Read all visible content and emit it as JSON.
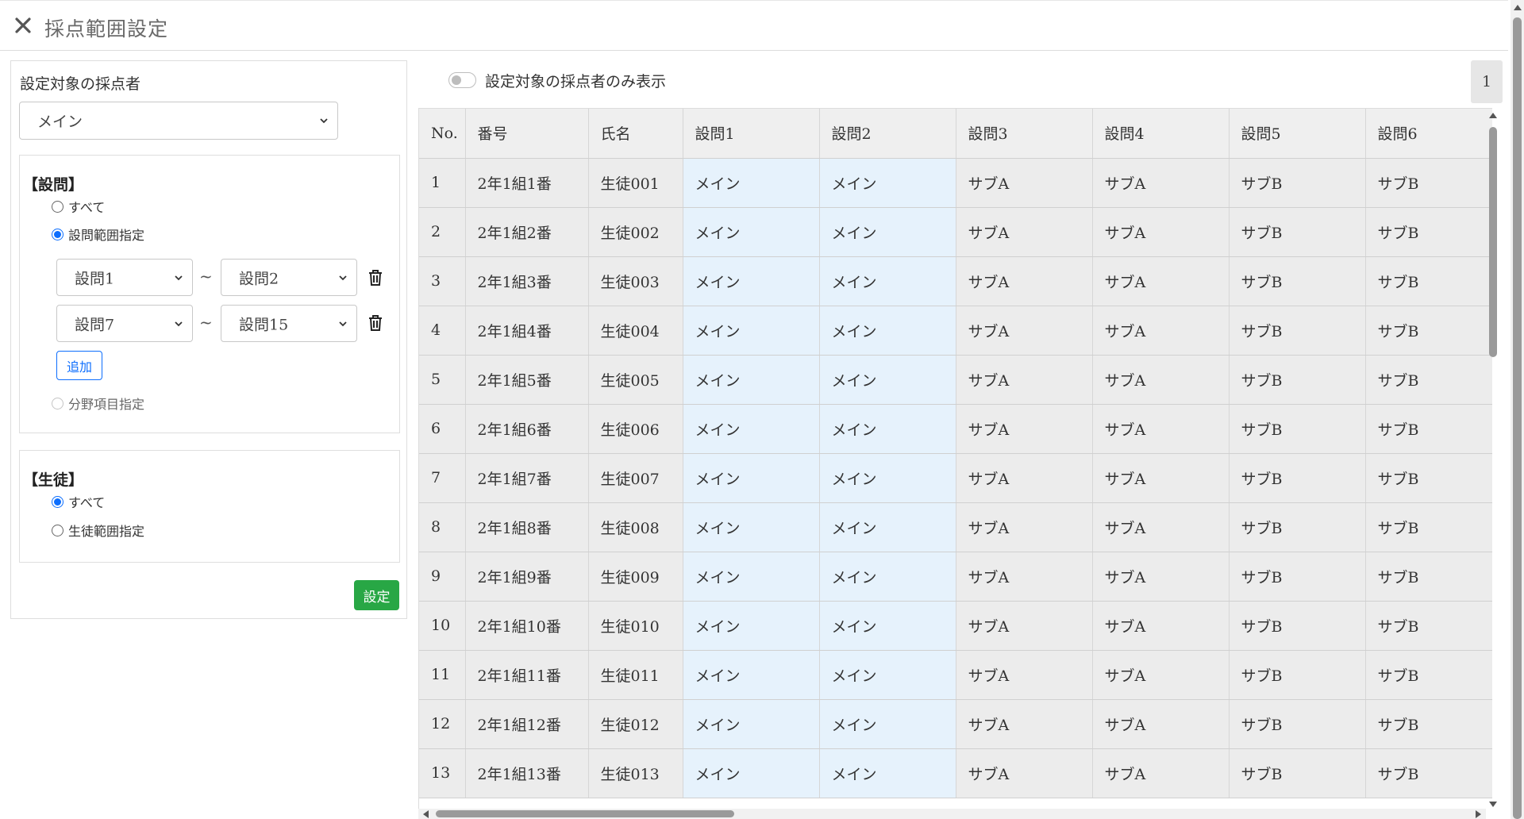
{
  "header": {
    "title": "採点範囲設定",
    "close_icon": "close-icon"
  },
  "panel": {
    "target_label": "設定対象の採点者",
    "target_value": "メイン",
    "questions": {
      "heading": "【設問】",
      "opt_all": "すべて",
      "opt_range": "設問範囲指定",
      "selected": "range",
      "ranges": [
        {
          "from": "設問1",
          "to": "設問2"
        },
        {
          "from": "設問7",
          "to": "設問15"
        }
      ],
      "tilde": "~",
      "add_label": "追加",
      "opt_field": "分野項目指定"
    },
    "students": {
      "heading": "【生徒】",
      "opt_all": "すべて",
      "opt_range": "生徒範囲指定",
      "selected": "all"
    },
    "set_label": "設定"
  },
  "toolbar": {
    "toggle_label": "設定対象の採点者のみ表示",
    "toggle_on": false,
    "page": "1"
  },
  "table": {
    "columns": [
      "No.",
      "番号",
      "氏名",
      "設問1",
      "設問2",
      "設問3",
      "設問4",
      "設問5",
      "設問6"
    ],
    "rows": [
      [
        "1",
        "2年1組1番",
        "生徒001",
        "メイン",
        "メイン",
        "サブA",
        "サブA",
        "サブB",
        "サブB"
      ],
      [
        "2",
        "2年1組2番",
        "生徒002",
        "メイン",
        "メイン",
        "サブA",
        "サブA",
        "サブB",
        "サブB"
      ],
      [
        "3",
        "2年1組3番",
        "生徒003",
        "メイン",
        "メイン",
        "サブA",
        "サブA",
        "サブB",
        "サブB"
      ],
      [
        "4",
        "2年1組4番",
        "生徒004",
        "メイン",
        "メイン",
        "サブA",
        "サブA",
        "サブB",
        "サブB"
      ],
      [
        "5",
        "2年1組5番",
        "生徒005",
        "メイン",
        "メイン",
        "サブA",
        "サブA",
        "サブB",
        "サブB"
      ],
      [
        "6",
        "2年1組6番",
        "生徒006",
        "メイン",
        "メイン",
        "サブA",
        "サブA",
        "サブB",
        "サブB"
      ],
      [
        "7",
        "2年1組7番",
        "生徒007",
        "メイン",
        "メイン",
        "サブA",
        "サブA",
        "サブB",
        "サブB"
      ],
      [
        "8",
        "2年1組8番",
        "生徒008",
        "メイン",
        "メイン",
        "サブA",
        "サブA",
        "サブB",
        "サブB"
      ],
      [
        "9",
        "2年1組9番",
        "生徒009",
        "メイン",
        "メイン",
        "サブA",
        "サブA",
        "サブB",
        "サブB"
      ],
      [
        "10",
        "2年1組10番",
        "生徒010",
        "メイン",
        "メイン",
        "サブA",
        "サブA",
        "サブB",
        "サブB"
      ],
      [
        "11",
        "2年1組11番",
        "生徒011",
        "メイン",
        "メイン",
        "サブA",
        "サブA",
        "サブB",
        "サブB"
      ],
      [
        "12",
        "2年1組12番",
        "生徒012",
        "メイン",
        "メイン",
        "サブA",
        "サブA",
        "サブB",
        "サブB"
      ],
      [
        "13",
        "2年1組13番",
        "生徒013",
        "メイン",
        "メイン",
        "サブA",
        "サブA",
        "サブB",
        "サブB"
      ]
    ],
    "highlight_cols": [
      3,
      4
    ],
    "highlight_color": "#e6f2fc"
  },
  "colors": {
    "primary": "#0d6efd",
    "success": "#28a745"
  }
}
